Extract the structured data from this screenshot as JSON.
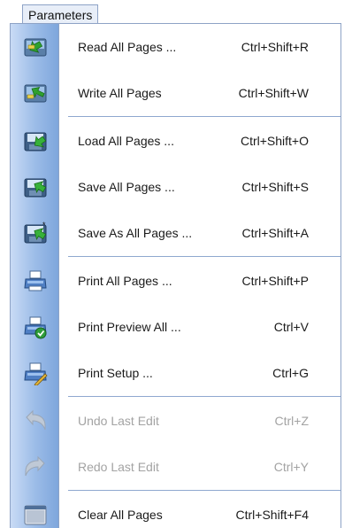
{
  "menu": {
    "title": "Parameters",
    "items": [
      {
        "label": "Read All Pages ...",
        "shortcut": "Ctrl+Shift+R",
        "icon": "read-all-pages-icon",
        "enabled": true
      },
      {
        "label": "Write All Pages",
        "shortcut": "Ctrl+Shift+W",
        "icon": "write-all-pages-icon",
        "enabled": true
      },
      {
        "label": "Load All Pages ...",
        "shortcut": "Ctrl+Shift+O",
        "icon": "load-all-pages-icon",
        "enabled": true
      },
      {
        "label": "Save All Pages ...",
        "shortcut": "Ctrl+Shift+S",
        "icon": "save-all-pages-icon",
        "enabled": true
      },
      {
        "label": "Save As All Pages ...",
        "shortcut": "Ctrl+Shift+A",
        "icon": "save-as-all-pages-icon",
        "enabled": true
      },
      {
        "label": "Print All Pages ...",
        "shortcut": "Ctrl+Shift+P",
        "icon": "printer-icon",
        "enabled": true
      },
      {
        "label": "Print Preview All ...",
        "shortcut": "Ctrl+V",
        "icon": "print-preview-icon",
        "enabled": true
      },
      {
        "label": "Print Setup ...",
        "shortcut": "Ctrl+G",
        "icon": "print-setup-icon",
        "enabled": true
      },
      {
        "label": "Undo Last Edit",
        "shortcut": "Ctrl+Z",
        "icon": "undo-icon",
        "enabled": false
      },
      {
        "label": "Redo Last Edit",
        "shortcut": "Ctrl+Y",
        "icon": "redo-icon",
        "enabled": false
      },
      {
        "label": "Clear All Pages",
        "shortcut": "Ctrl+Shift+F4",
        "icon": "clear-all-pages-icon",
        "enabled": true
      }
    ]
  },
  "colors": {
    "gutter_light": "#c9dbf5",
    "gutter_dark": "#7ea6dc",
    "separator": "#8fa8cf",
    "disabled_text": "#a3a3a3"
  }
}
